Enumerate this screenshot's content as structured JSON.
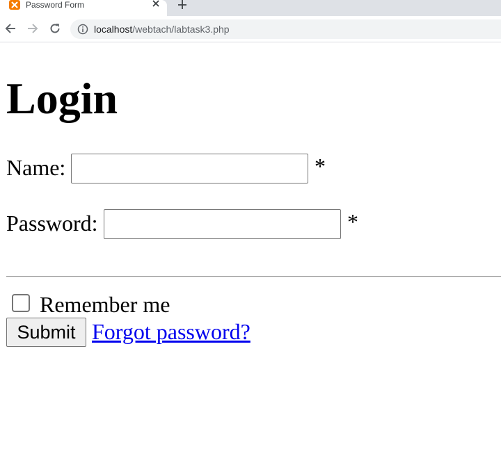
{
  "browser": {
    "tab_title": "Password Form",
    "url_host": "localhost",
    "url_path": "/webtach/labtask3.php",
    "favicon": "xampp-icon"
  },
  "form": {
    "heading": "Login",
    "name_label": "Name:",
    "name_value": "",
    "name_required": "*",
    "password_label": "Password:",
    "password_value": "",
    "password_required": "*",
    "remember_label": "Remember me",
    "remember_checked": false,
    "submit_label": "Submit",
    "forgot_link": "Forgot password?"
  },
  "colors": {
    "link": "#0000ee",
    "tab_strip": "#dee1e6",
    "omnibox": "#f1f3f4",
    "favicon": "#f57c00"
  }
}
